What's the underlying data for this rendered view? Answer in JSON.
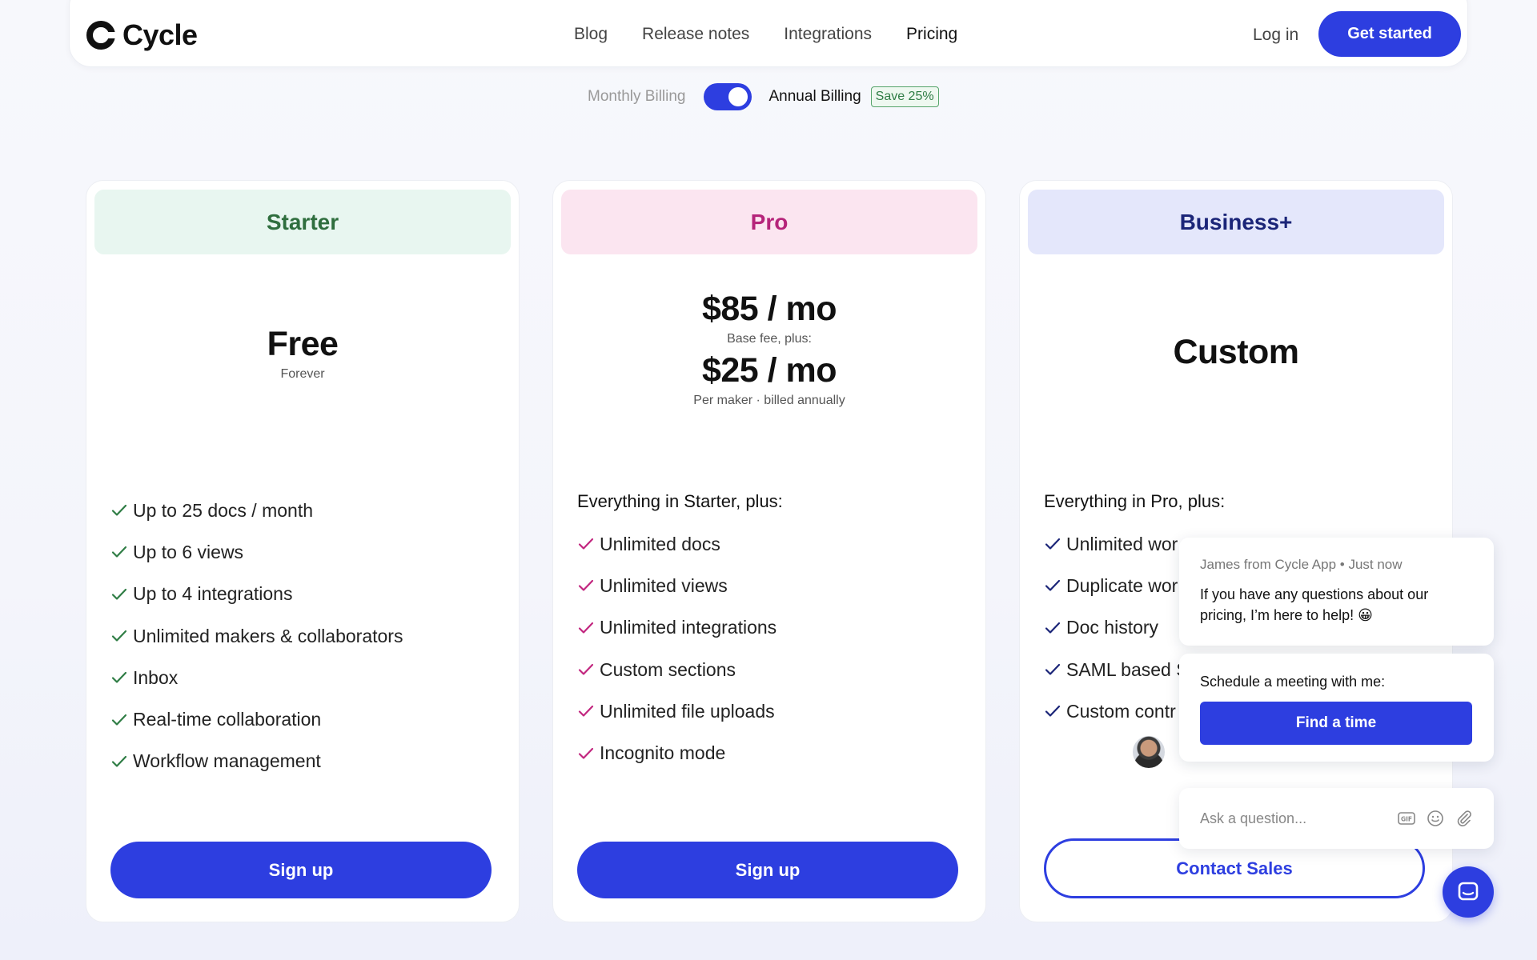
{
  "brand": {
    "name": "Cycle",
    "accent": "#2d3ee0"
  },
  "nav": {
    "items": [
      {
        "label": "Blog"
      },
      {
        "label": "Release notes"
      },
      {
        "label": "Integrations"
      },
      {
        "label": "Pricing",
        "active": true
      }
    ],
    "login": "Log in",
    "cta": "Get started"
  },
  "billing": {
    "monthly": "Monthly Billing",
    "annual": "Annual Billing",
    "save": "Save 25%",
    "annual_selected": true
  },
  "plans": [
    {
      "name": "Starter",
      "head_bg": "#e8f6f0",
      "head_color": "#2f6e3e",
      "check_color": "#2f7d45",
      "price": "Free",
      "price_note": "Forever",
      "features_title": "",
      "features": [
        "Up to 25 docs / month",
        "Up to 6 views",
        "Up to 4 integrations",
        "Unlimited makers & collaborators",
        "Inbox",
        "Real-time collaboration",
        "Workflow management"
      ],
      "button": "Sign up"
    },
    {
      "name": "Pro",
      "head_bg": "#fbe5f0",
      "head_color": "#b5247a",
      "check_color": "#c2267f",
      "price": "$85 / mo",
      "price_note": "Base fee, plus:",
      "price2": "$25 / mo",
      "price2_note": "Per maker · billed annually",
      "features_title": "Everything in Starter, plus:",
      "features": [
        "Unlimited docs",
        "Unlimited views",
        "Unlimited integrations",
        "Custom sections",
        "Unlimited file uploads",
        "Incognito mode"
      ],
      "button": "Sign up"
    },
    {
      "name": "Business+",
      "head_bg": "#e4e7fb",
      "head_color": "#1b2578",
      "check_color": "#1b2578",
      "price": "Custom",
      "features_title": "Everything in Pro, plus:",
      "features": [
        "Unlimited wor",
        "Duplicate wor",
        "Doc history",
        "SAML based S",
        "Custom contr"
      ],
      "button": "Contact Sales"
    }
  ],
  "chat": {
    "meta": "James from Cycle App • Just now",
    "message": "If you have any questions about our pricing, I’m here to help! 😀",
    "schedule_label": "Schedule a meeting with me:",
    "schedule_button": "Find a time",
    "input_placeholder": "Ask a question...",
    "icons": [
      "gif-icon",
      "emoji-icon",
      "paperclip-icon"
    ],
    "launcher_icon": "chat-bubble-icon"
  }
}
